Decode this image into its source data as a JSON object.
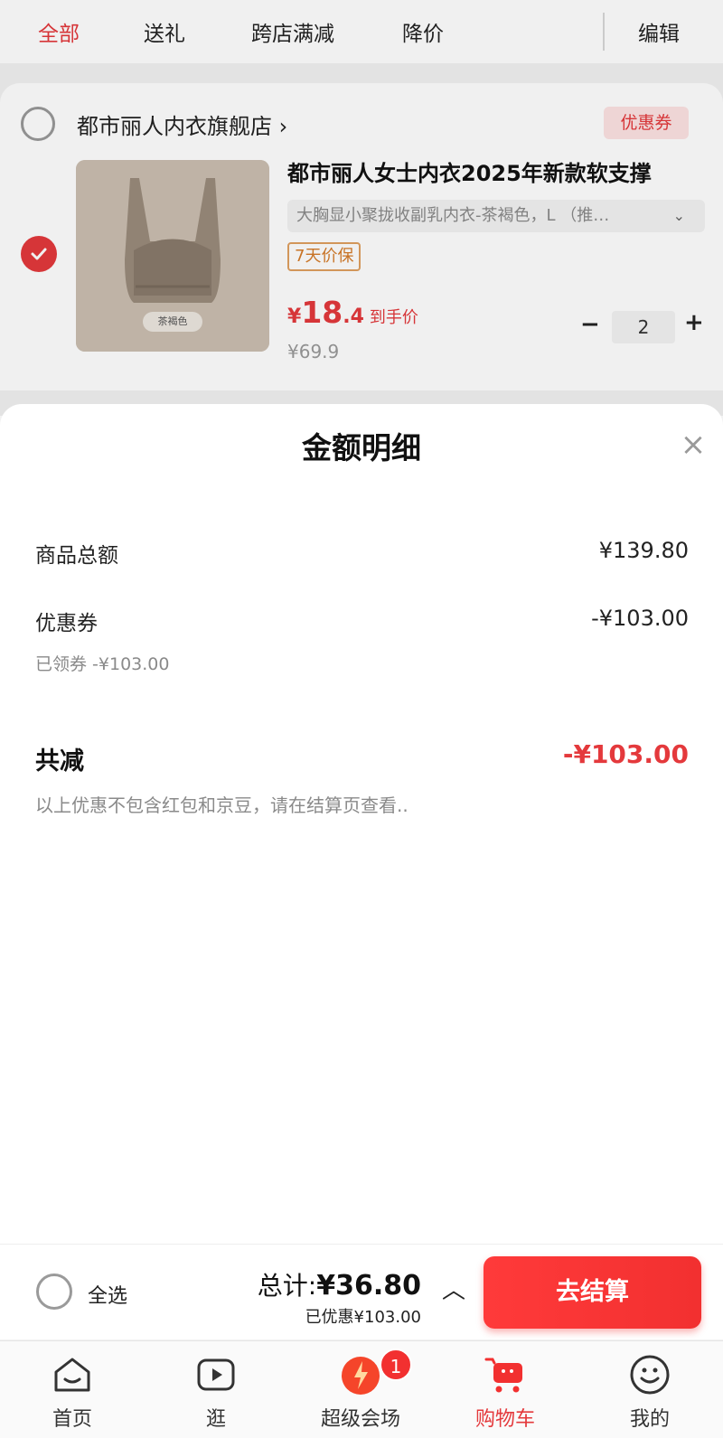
{
  "filter_tabs": [
    {
      "label": "全部",
      "active": true
    },
    {
      "label": "送礼",
      "active": false
    },
    {
      "label": "跨店满减",
      "active": false
    },
    {
      "label": "降价",
      "active": false
    }
  ],
  "edit_label": "编辑",
  "shop": {
    "name": "都市丽人内衣旗舰店 ›",
    "coupon_tag": "优惠券"
  },
  "product": {
    "title": "都市丽人女士内衣2025年新款软支撑",
    "sku": "大胸显小聚拢收副乳内衣-茶褐色，L （推…",
    "image_color_label": "茶褐色",
    "guarantee": "7天价保",
    "price_symbol": "¥",
    "price_int": "18",
    "price_dec": ".4",
    "price_label": "到手价",
    "original_price": "¥69.9",
    "quantity": "2"
  },
  "sheet": {
    "title": "金额明细",
    "goods_total_label": "商品总额",
    "goods_total_value": "¥139.80",
    "coupon_label": "优惠券",
    "coupon_value": "-¥103.00",
    "coupon_sub": "已领券 -¥103.00",
    "total_reduce_label": "共减",
    "total_reduce_value": "-¥103.00",
    "note": "以上优惠不包含红包和京豆，请在结算页查看.."
  },
  "checkout": {
    "select_all_label": "全选",
    "total_prefix": "总计:",
    "total_amount": "¥36.80",
    "saved": "已优惠¥103.00",
    "button_label": "去结算"
  },
  "tabbar": [
    {
      "label": "首页",
      "icon": "home-icon"
    },
    {
      "label": "逛",
      "icon": "play-icon"
    },
    {
      "label": "超级会场",
      "icon": "super-venue-icon",
      "badge": "1"
    },
    {
      "label": "购物车",
      "icon": "cart-icon",
      "active": true
    },
    {
      "label": "我的",
      "icon": "smiley-icon"
    }
  ],
  "colors": {
    "accent": "#e4393c",
    "checkout_button": "#f23030",
    "guarantee_border": "#e0a060"
  }
}
